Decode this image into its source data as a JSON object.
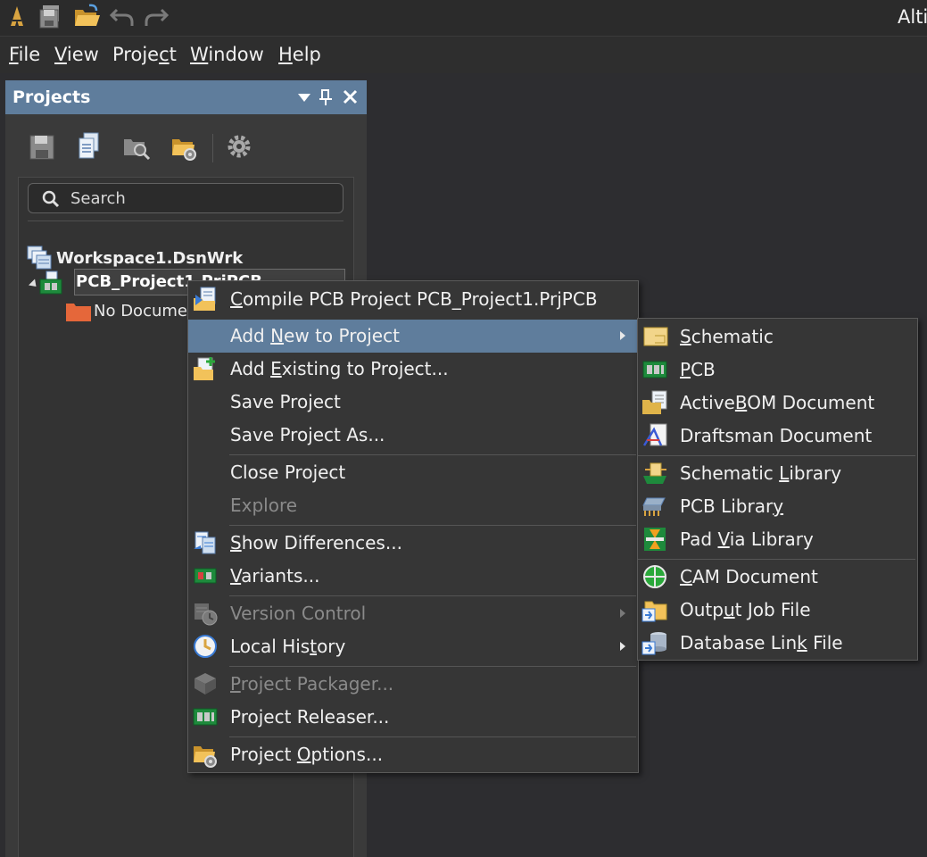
{
  "app": {
    "title": "Alti"
  },
  "menubar": {
    "items": [
      {
        "pre": "",
        "ul": "F",
        "post": "ile"
      },
      {
        "pre": "",
        "ul": "V",
        "post": "iew"
      },
      {
        "pre": "Proje",
        "ul": "c",
        "post": "t"
      },
      {
        "pre": "",
        "ul": "W",
        "post": "indow"
      },
      {
        "pre": "",
        "ul": "H",
        "post": "elp"
      }
    ]
  },
  "panel": {
    "title": "Projects",
    "search_placeholder": "Search",
    "tree": {
      "workspace": "Workspace1.DsnWrk",
      "project": "PCB_Project1.PrjPCB",
      "no_documents": "No Documents"
    }
  },
  "context_menu": {
    "compile": {
      "pre": "",
      "ul": "C",
      "post": "ompile PCB Project PCB_Project1.PrjPCB"
    },
    "add_new": {
      "pre": "Add ",
      "ul": "N",
      "post": "ew to Project"
    },
    "add_existing": {
      "pre": "Add ",
      "ul": "E",
      "post": "xisting to Project..."
    },
    "save_project": {
      "pre": "Save Project",
      "ul": "",
      "post": ""
    },
    "save_project_as": {
      "pre": "Save Project As...",
      "ul": "",
      "post": ""
    },
    "close_project": {
      "pre": "Close Project",
      "ul": "",
      "post": ""
    },
    "explore": {
      "pre": "Explore",
      "ul": "",
      "post": ""
    },
    "show_differences": {
      "pre": "",
      "ul": "S",
      "post": "how Differences..."
    },
    "variants": {
      "pre": "",
      "ul": "V",
      "post": "ariants..."
    },
    "version_control": {
      "pre": "Version Control",
      "ul": "",
      "post": ""
    },
    "local_history": {
      "pre": "Local His",
      "ul": "t",
      "post": "ory"
    },
    "project_packager": {
      "pre": "",
      "ul": "P",
      "post": "roject Packager..."
    },
    "project_releaser": {
      "pre": "Project Releaser...",
      "ul": "",
      "post": ""
    },
    "project_options": {
      "pre": "Project ",
      "ul": "O",
      "post": "ptions..."
    }
  },
  "submenu": {
    "schematic": {
      "pre": "",
      "ul": "S",
      "post": "chematic"
    },
    "pcb": {
      "pre": "",
      "ul": "P",
      "post": "CB"
    },
    "activebom": {
      "pre": "Active",
      "ul": "B",
      "post": "OM Document"
    },
    "draftsman": {
      "pre": "Draftsman Document",
      "ul": "",
      "post": ""
    },
    "schematic_library": {
      "pre": "Schematic ",
      "ul": "L",
      "post": "ibrary"
    },
    "pcb_library": {
      "pre": "PCB Librar",
      "ul": "y",
      "post": ""
    },
    "pad_via_library": {
      "pre": "Pad ",
      "ul": "V",
      "post": "ia Library"
    },
    "cam_document": {
      "pre": "",
      "ul": "C",
      "post": "AM Document"
    },
    "output_job_file": {
      "pre": "Outp",
      "ul": "u",
      "post": "t Job File"
    },
    "database_link_file": {
      "pre": "Database Lin",
      "ul": "k",
      "post": " File"
    }
  }
}
